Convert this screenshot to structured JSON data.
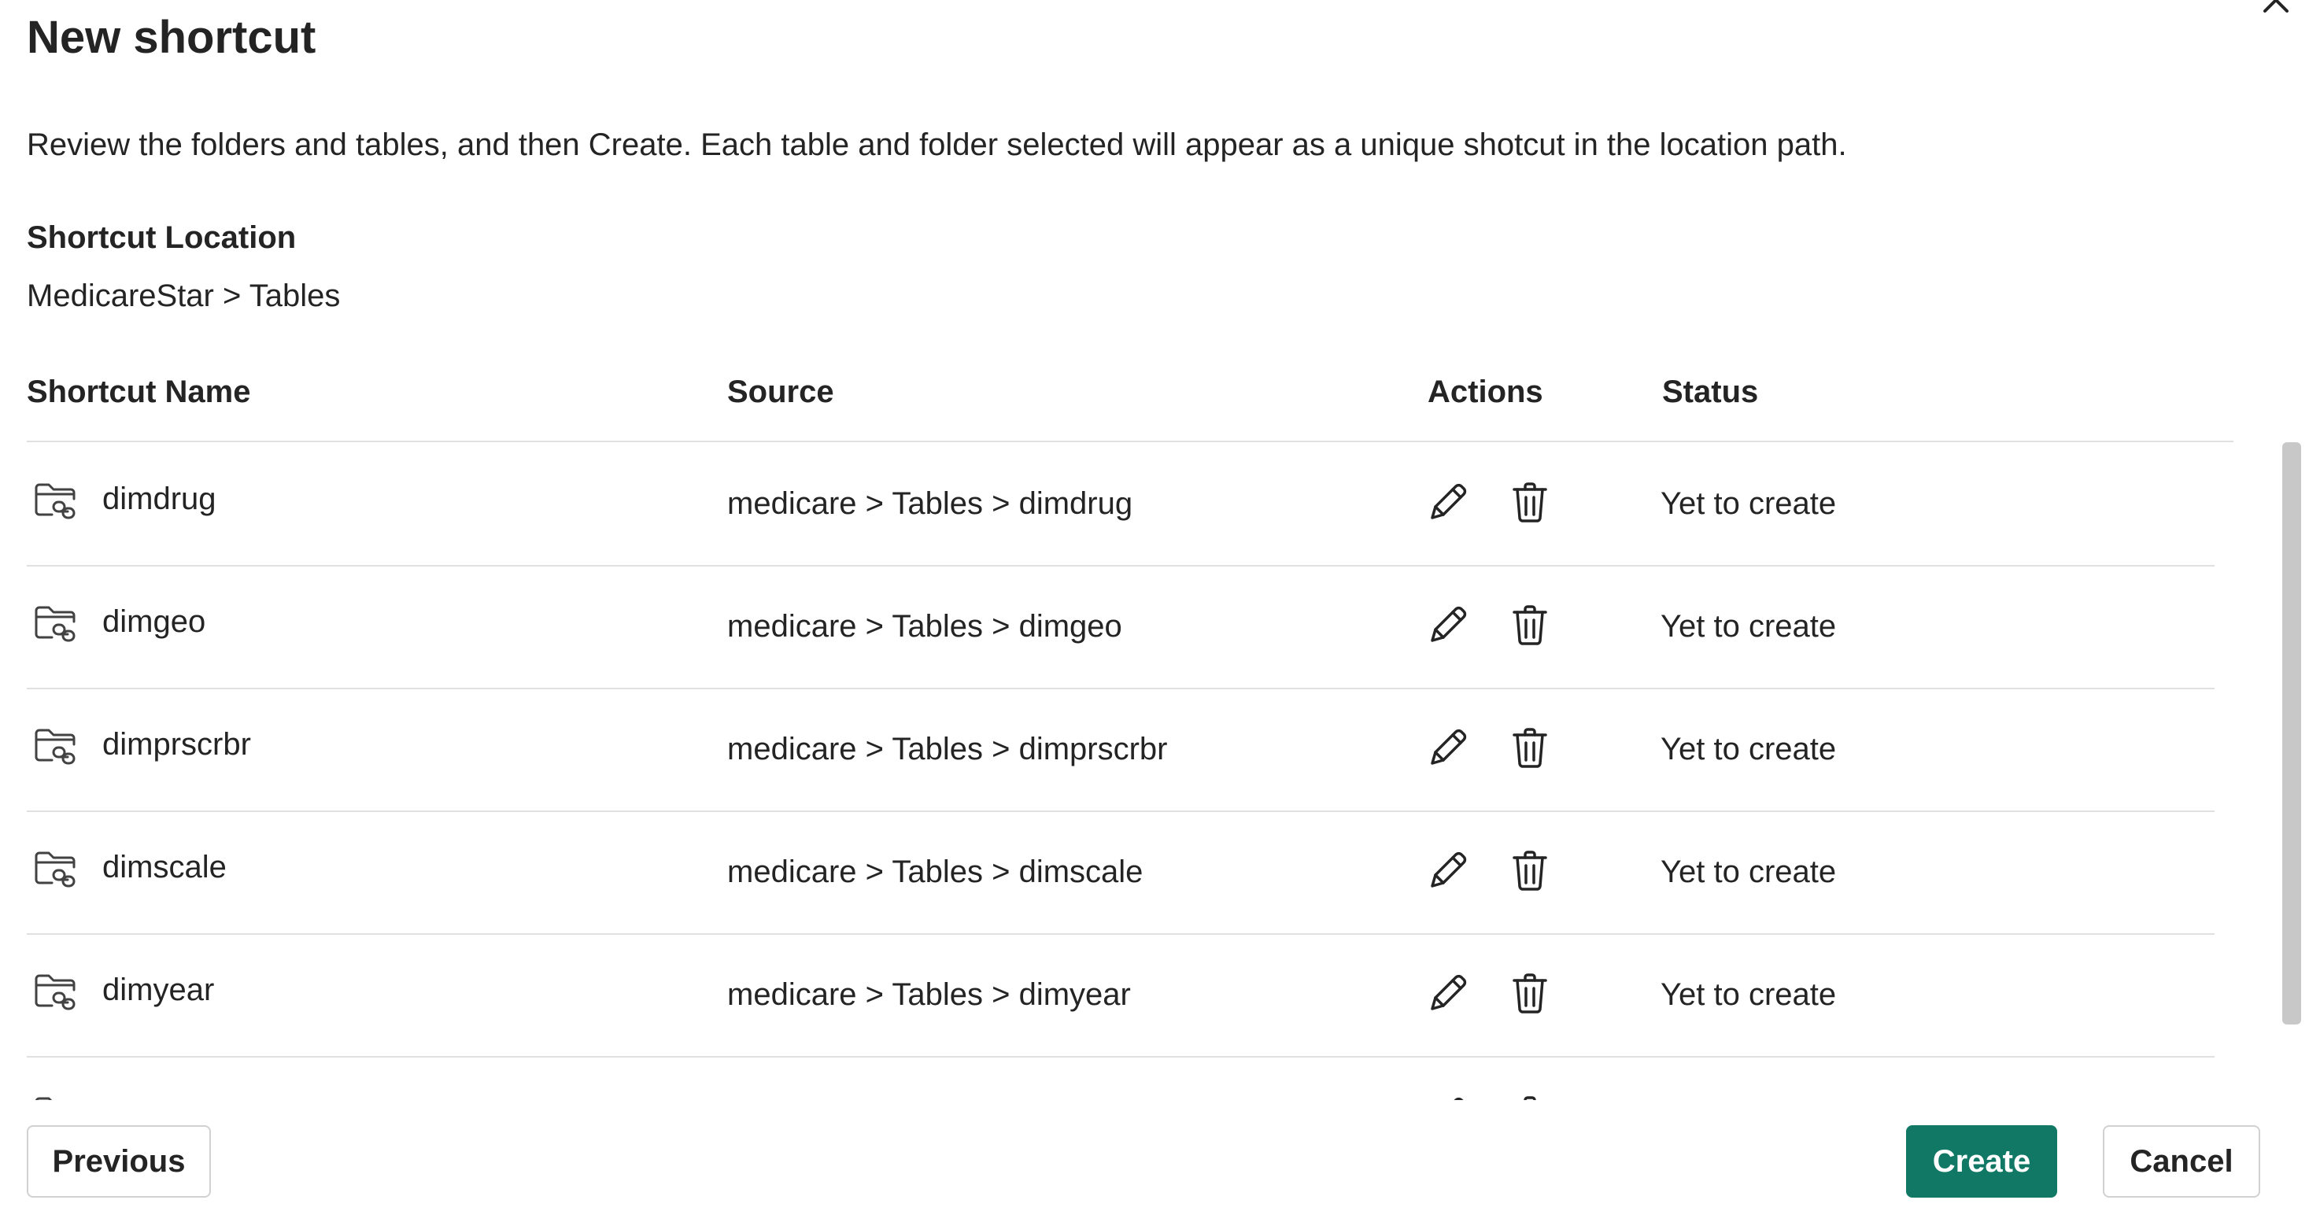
{
  "dialog": {
    "title": "New shortcut",
    "description": "Review the folders and tables, and then Create. Each table and folder selected will appear as a unique shotcut in the location path.",
    "location_label": "Shortcut Location",
    "location_path": "MedicareStar > Tables"
  },
  "table": {
    "columns": [
      "Shortcut Name",
      "Source",
      "Actions",
      "Status"
    ],
    "rows": [
      {
        "name": "dimdrug",
        "source": "medicare > Tables > dimdrug",
        "status": "Yet to create"
      },
      {
        "name": "dimgeo",
        "source": "medicare > Tables > dimgeo",
        "status": "Yet to create"
      },
      {
        "name": "dimprscrbr",
        "source": "medicare > Tables > dimprscrbr",
        "status": "Yet to create"
      },
      {
        "name": "dimscale",
        "source": "medicare > Tables > dimscale",
        "status": "Yet to create"
      },
      {
        "name": "dimyear",
        "source": "medicare > Tables > dimyear",
        "status": "Yet to create"
      },
      {
        "name": "",
        "source": "",
        "status": ""
      }
    ]
  },
  "footer": {
    "previous_label": "Previous",
    "create_label": "Create",
    "cancel_label": "Cancel"
  },
  "colors": {
    "primary": "#117865",
    "divider": "#e0e0e0",
    "text": "#242424"
  },
  "icons": {
    "row_icon": "folder-link-icon",
    "edit": "pencil-icon",
    "delete": "trash-icon",
    "close": "close-icon"
  }
}
